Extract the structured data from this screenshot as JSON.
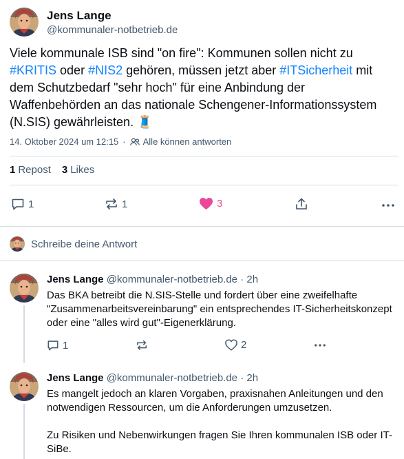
{
  "post": {
    "author_name": "Jens Lange",
    "author_handle": "@kommunaler-notbetrieb.de",
    "text_parts": {
      "p1": "Viele kommunale ISB sind \"on fire\": Kommunen sollen nicht zu ",
      "tag1": "#KRITIS",
      "p2": " oder ",
      "tag2": "#NIS2",
      "p3": " gehören, müssen jetzt aber ",
      "tag3": "#ITSicherheit",
      "p4": " mit dem Schutzbedarf \"sehr hoch\" für eine Anbindung der Waffenbehörden an das nationale Schengener-Informationssystem (N.SIS) gewährleisten. ",
      "emoji": "🧵"
    },
    "timestamp": "14. Oktober 2024 um 12:15",
    "reply_setting": "Alle können antworten",
    "stats": {
      "reposts_count": "1",
      "reposts_label": "Repost",
      "likes_count": "3",
      "likes_label": "Likes"
    },
    "actions": {
      "reply_count": "1",
      "repost_count": "1",
      "like_count": "3"
    }
  },
  "compose": {
    "placeholder": "Schreibe deine Antwort"
  },
  "replies": [
    {
      "author_name": "Jens Lange",
      "author_handle": "@kommunaler-notbetrieb.de",
      "time": "· 2h",
      "text": "Das BKA betreibt die N.SIS-Stelle und fordert über eine zweifelhafte \"Zusammenarbeitsvereinbarung\" ein entsprechendes IT-Sicherheitskonzept oder eine \"alles wird gut\"-Eigenerklärung.",
      "reply_count": "1",
      "like_count": "2"
    },
    {
      "author_name": "Jens Lange",
      "author_handle": "@kommunaler-notbetrieb.de",
      "time": "· 2h",
      "text_p1": "Es mangelt jedoch an klaren Vorgaben, praxisnahen Anleitungen und den notwendigen Ressourcen, um die Anforderungen umzusetzen.",
      "text_p2": "Zu Risiken und Nebenwirkungen fragen Sie Ihren kommunalen ISB oder IT-SiBe."
    }
  ],
  "colors": {
    "accent": "#1083fe",
    "like": "#ec4899",
    "muted": "#42576c",
    "divider": "#d4dbe2"
  }
}
